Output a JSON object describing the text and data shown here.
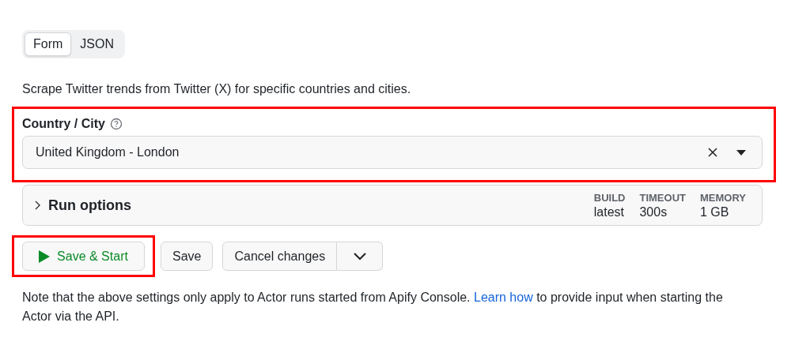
{
  "tabs": [
    {
      "label": "Form",
      "selected": true
    },
    {
      "label": "JSON",
      "selected": false
    }
  ],
  "description": "Scrape Twitter trends from Twitter (X) for specific countries and cities.",
  "field": {
    "label": "Country / City",
    "value": "United Kingdom - London",
    "highlighted": true
  },
  "run_options": {
    "title": "Run options",
    "expanded": false,
    "stats": [
      {
        "label": "BUILD",
        "value": "latest"
      },
      {
        "label": "TIMEOUT",
        "value": "300s"
      },
      {
        "label": "MEMORY",
        "value": "1 GB"
      }
    ]
  },
  "buttons": [
    {
      "kind": "primary",
      "label": "Save & Start",
      "highlighted": true
    },
    {
      "kind": "plain",
      "label": "Save",
      "highlighted": false
    },
    {
      "kind": "split",
      "label": "Cancel changes",
      "highlighted": false
    }
  ],
  "note": {
    "text": "Note that the above settings only apply to Actor runs started from Apify Console.",
    "link": "Learn how",
    "after": "to provide input when starting the Actor via the API."
  }
}
